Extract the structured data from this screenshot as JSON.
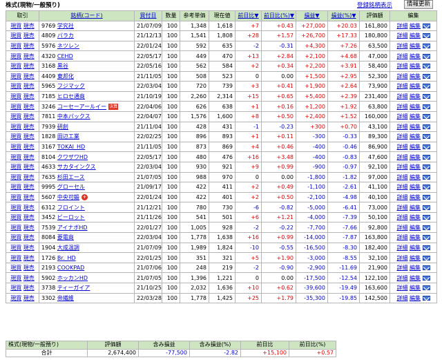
{
  "header": {
    "title": "株式(現物/一般預り)",
    "register_label": "登録銘柄表示",
    "refresh_label": "情報更新"
  },
  "columns": [
    "取引",
    "銘柄(コード)",
    "買付日",
    "数量",
    "参考単価",
    "現在値",
    "前日比",
    "前日比(%)",
    "損益",
    "損益(%)",
    "評価額",
    "編集"
  ],
  "sort_arrows": {
    "prev_day": "▼",
    "prev_day_pct": "▼",
    "pl": "▼",
    "pl_pct": "▼"
  },
  "action_labels": {
    "buy": "現買",
    "sell": "現売",
    "detail": "詳細",
    "edit": "編集"
  },
  "rows": [
    {
      "code": "9769",
      "name": "学究社",
      "date": "21/07/09",
      "qty": "100",
      "ref": "1,348",
      "cur": "1,618",
      "chg": "+7",
      "chg_pct": "+0.43",
      "pl": "+27,000",
      "pl_pct": "+20.03",
      "val": "161,800"
    },
    {
      "code": "4809",
      "name": "パラカ",
      "date": "21/12/13",
      "qty": "100",
      "ref": "1,541",
      "cur": "1,808",
      "chg": "+28",
      "chg_pct": "+1.57",
      "pl": "+26,700",
      "pl_pct": "+17.33",
      "val": "180,800"
    },
    {
      "code": "5976",
      "name": "ネツレン",
      "date": "22/01/24",
      "qty": "100",
      "ref": "592",
      "cur": "635",
      "chg": "-2",
      "chg_pct": "-0.31",
      "pl": "+4,300",
      "pl_pct": "+7.26",
      "val": "63,500"
    },
    {
      "code": "4320",
      "name": "CEHD",
      "date": "22/05/17",
      "qty": "100",
      "ref": "449",
      "cur": "470",
      "chg": "+13",
      "chg_pct": "+2.84",
      "pl": "+2,100",
      "pl_pct": "+4.68",
      "val": "47,000"
    },
    {
      "code": "3168",
      "name": "黒谷",
      "date": "22/05/16",
      "qty": "100",
      "ref": "562",
      "cur": "584",
      "chg": "+2",
      "chg_pct": "+0.34",
      "pl": "+2,200",
      "pl_pct": "+3.91",
      "val": "58,400"
    },
    {
      "code": "4409",
      "name": "東邦化",
      "date": "21/11/05",
      "qty": "100",
      "ref": "508",
      "cur": "523",
      "chg": "0",
      "chg_pct": "0.00",
      "pl": "+1,500",
      "pl_pct": "+2.95",
      "val": "52,300"
    },
    {
      "code": "5965",
      "name": "フジマック",
      "date": "22/03/04",
      "qty": "100",
      "ref": "720",
      "cur": "739",
      "chg": "+3",
      "chg_pct": "+0.41",
      "pl": "+1,900",
      "pl_pct": "+2.64",
      "val": "73,900"
    },
    {
      "code": "7185",
      "name": "ヒロセ通商",
      "date": "21/10/19",
      "qty": "100",
      "ref": "2,260",
      "cur": "2,314",
      "chg": "+15",
      "chg_pct": "+0.65",
      "pl": "+5,400",
      "pl_pct": "+2.39",
      "val": "231,400"
    },
    {
      "code": "3246",
      "name": "コーセーアールイー",
      "badge": "決算",
      "date": "22/04/06",
      "qty": "100",
      "ref": "626",
      "cur": "638",
      "chg": "+1",
      "chg_pct": "+0.16",
      "pl": "+1,200",
      "pl_pct": "+1.92",
      "val": "63,800"
    },
    {
      "code": "7811",
      "name": "中本パックス",
      "date": "22/04/07",
      "qty": "100",
      "ref": "1,576",
      "cur": "1,600",
      "chg": "+8",
      "chg_pct": "+0.50",
      "pl": "+2,400",
      "pl_pct": "+1.52",
      "val": "160,000"
    },
    {
      "code": "7939",
      "name": "研創",
      "date": "21/11/04",
      "qty": "100",
      "ref": "428",
      "cur": "431",
      "chg": "-1",
      "chg_pct": "-0.23",
      "pl": "+300",
      "pl_pct": "+0.70",
      "val": "43,100"
    },
    {
      "code": "1828",
      "name": "田辺工業",
      "date": "22/02/25",
      "qty": "100",
      "ref": "896",
      "cur": "893",
      "chg": "+1",
      "chg_pct": "+0.11",
      "pl": "-300",
      "pl_pct": "-0.33",
      "val": "89,300"
    },
    {
      "code": "3167",
      "name": "TOKAI_HD",
      "date": "21/11/05",
      "qty": "100",
      "ref": "873",
      "cur": "869",
      "chg": "+4",
      "chg_pct": "+0.46",
      "pl": "-400",
      "pl_pct": "-0.46",
      "val": "86,900"
    },
    {
      "code": "8104",
      "name": "クワザワHD",
      "date": "22/05/17",
      "qty": "100",
      "ref": "480",
      "cur": "476",
      "chg": "+16",
      "chg_pct": "+3.48",
      "pl": "-400",
      "pl_pct": "-0.83",
      "val": "47,600"
    },
    {
      "code": "4633",
      "name": "サカタインクス",
      "date": "22/03/04",
      "qty": "100",
      "ref": "930",
      "cur": "921",
      "chg": "+9",
      "chg_pct": "+0.99",
      "pl": "-900",
      "pl_pct": "-0.97",
      "val": "92,100"
    },
    {
      "code": "7635",
      "name": "杉田エース",
      "date": "21/07/05",
      "qty": "100",
      "ref": "988",
      "cur": "970",
      "chg": "0",
      "chg_pct": "0.00",
      "pl": "-1,800",
      "pl_pct": "-1.82",
      "val": "97,000"
    },
    {
      "code": "9995",
      "name": "グローセル",
      "date": "21/09/17",
      "qty": "100",
      "ref": "422",
      "cur": "411",
      "chg": "+2",
      "chg_pct": "+0.49",
      "pl": "-1,100",
      "pl_pct": "-2.61",
      "val": "41,100"
    },
    {
      "code": "5607",
      "name": "中央可鍛",
      "badge": "+",
      "date": "22/01/24",
      "qty": "100",
      "ref": "422",
      "cur": "401",
      "chg": "+2",
      "chg_pct": "+0.50",
      "pl": "-2,100",
      "pl_pct": "-4.98",
      "val": "40,100"
    },
    {
      "code": "6312",
      "name": "フロイント",
      "date": "21/12/21",
      "qty": "100",
      "ref": "780",
      "cur": "730",
      "chg": "-6",
      "chg_pct": "-0.82",
      "pl": "-5,000",
      "pl_pct": "-6.41",
      "val": "73,000"
    },
    {
      "code": "3452",
      "name": "ビーロット",
      "date": "21/11/26",
      "qty": "100",
      "ref": "541",
      "cur": "501",
      "chg": "+6",
      "chg_pct": "+1.21",
      "pl": "-4,000",
      "pl_pct": "-7.39",
      "val": "50,100"
    },
    {
      "code": "7539",
      "name": "アイナボHD",
      "date": "22/01/27",
      "qty": "100",
      "ref": "1,005",
      "cur": "928",
      "chg": "-2",
      "chg_pct": "-0.22",
      "pl": "-7,700",
      "pl_pct": "-7.66",
      "val": "92,800"
    },
    {
      "code": "8084",
      "name": "菱電商",
      "date": "22/03/04",
      "qty": "100",
      "ref": "1,778",
      "cur": "1,638",
      "chg": "+16",
      "chg_pct": "+0.99",
      "pl": "-14,000",
      "pl_pct": "-7.87",
      "val": "163,800"
    },
    {
      "code": "1904",
      "name": "大成温調",
      "date": "21/07/09",
      "qty": "100",
      "ref": "1,989",
      "cur": "1,824",
      "chg": "-10",
      "chg_pct": "-0.55",
      "pl": "-16,500",
      "pl_pct": "-8.30",
      "val": "182,400"
    },
    {
      "code": "1726",
      "name": "Br._HD",
      "date": "22/01/25",
      "qty": "100",
      "ref": "351",
      "cur": "321",
      "chg": "+5",
      "chg_pct": "+1.90",
      "pl": "-3,000",
      "pl_pct": "-8.55",
      "val": "32,100"
    },
    {
      "code": "2193",
      "name": "COOKPAD",
      "date": "21/07/06",
      "qty": "100",
      "ref": "248",
      "cur": "219",
      "chg": "-2",
      "chg_pct": "-0.90",
      "pl": "-2,900",
      "pl_pct": "-11.69",
      "val": "21,900"
    },
    {
      "code": "5902",
      "name": "ホッカンHD",
      "date": "21/07/05",
      "qty": "100",
      "ref": "1,396",
      "cur": "1,221",
      "chg": "0",
      "chg_pct": "0.00",
      "pl": "-17,500",
      "pl_pct": "-12.54",
      "val": "122,100"
    },
    {
      "code": "3738",
      "name": "ティーガイア",
      "date": "21/10/25",
      "qty": "100",
      "ref": "2,032",
      "cur": "1,636",
      "chg": "+10",
      "chg_pct": "+0.62",
      "pl": "-39,600",
      "pl_pct": "-19.49",
      "val": "163,600"
    },
    {
      "code": "3302",
      "name": "帝繊維",
      "date": "22/03/28",
      "qty": "100",
      "ref": "1,778",
      "cur": "1,425",
      "chg": "+25",
      "chg_pct": "+1.79",
      "pl": "-35,300",
      "pl_pct": "-19.85",
      "val": "142,500"
    }
  ],
  "summary": {
    "label": "株式(現物/一般預り)",
    "total_label": "合計",
    "headers": [
      "評価額",
      "含み損益",
      "含み損益(%)",
      "前日比",
      "前日比(%)"
    ],
    "values": [
      "2,674,400",
      "-77,500",
      "-2.82",
      "+15,100",
      "+0.57"
    ]
  }
}
